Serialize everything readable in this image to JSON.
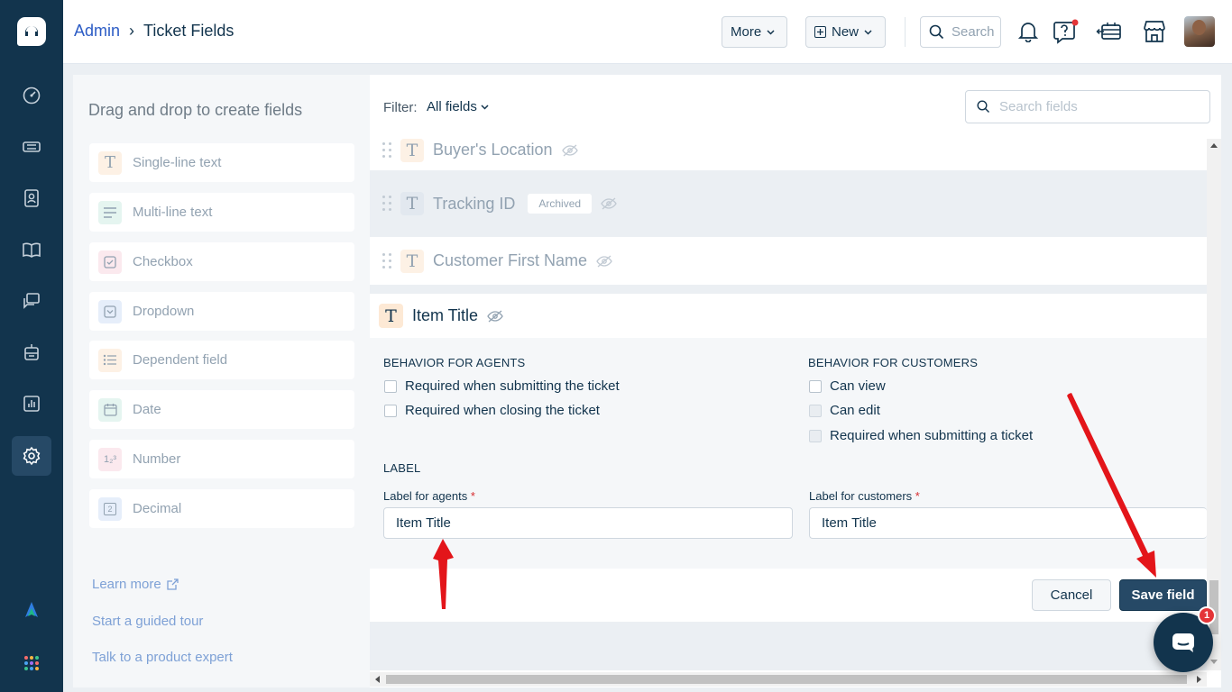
{
  "header": {
    "breadcrumb_root": "Admin",
    "breadcrumb_sep": "›",
    "page_title": "Ticket Fields",
    "more_label": "More",
    "new_label": "New",
    "search_placeholder": "Search"
  },
  "left_panel": {
    "title": "Drag and drop to create fields",
    "field_types": [
      {
        "label": "Single-line text",
        "icon": "text-icon"
      },
      {
        "label": "Multi-line text",
        "icon": "paragraph-icon"
      },
      {
        "label": "Checkbox",
        "icon": "checkbox-icon"
      },
      {
        "label": "Dropdown",
        "icon": "dropdown-icon"
      },
      {
        "label": "Dependent field",
        "icon": "list-icon"
      },
      {
        "label": "Date",
        "icon": "calendar-icon"
      },
      {
        "label": "Number",
        "icon": "number-icon",
        "glyph": "1₂³"
      },
      {
        "label": "Decimal",
        "icon": "decimal-icon",
        "glyph": "2"
      }
    ],
    "links": {
      "learn_more": "Learn more",
      "guided_tour": "Start a guided tour",
      "product_expert": "Talk to a product expert"
    }
  },
  "filter": {
    "label": "Filter:",
    "value": "All fields",
    "search_placeholder": "Search fields"
  },
  "fields": [
    {
      "name": "Buyer's Location",
      "glyph": "T",
      "archived": false
    },
    {
      "name": "Tracking ID",
      "glyph": "T",
      "archived": true,
      "badge": "Archived"
    },
    {
      "name": "Customer First Name",
      "glyph": "T",
      "archived": false
    }
  ],
  "editor": {
    "field_name": "Item Title",
    "glyph": "T",
    "agents_heading": "BEHAVIOR FOR AGENTS",
    "agents_options": [
      {
        "label": "Required when submitting the ticket",
        "checked": false
      },
      {
        "label": "Required when closing the ticket",
        "checked": false
      }
    ],
    "customers_heading": "BEHAVIOR FOR CUSTOMERS",
    "customers_options": [
      {
        "label": "Can view",
        "checked": false,
        "disabled": false
      },
      {
        "label": "Can edit",
        "checked": false,
        "disabled": true
      },
      {
        "label": "Required when submitting a ticket",
        "checked": false,
        "disabled": true
      }
    ],
    "label_heading": "LABEL",
    "agents_label_caption": "Label for agents",
    "agents_label_value": "Item Title",
    "customers_label_caption": "Label for customers",
    "customers_label_value": "Item Title",
    "required_mark": "*",
    "cancel_label": "Cancel",
    "save_label": "Save field"
  },
  "chat": {
    "badge_count": "1"
  },
  "colors": {
    "brand": "#12344d",
    "link": "#2c5cc5",
    "annotation": "#e3151a",
    "required": "#d72d30"
  }
}
